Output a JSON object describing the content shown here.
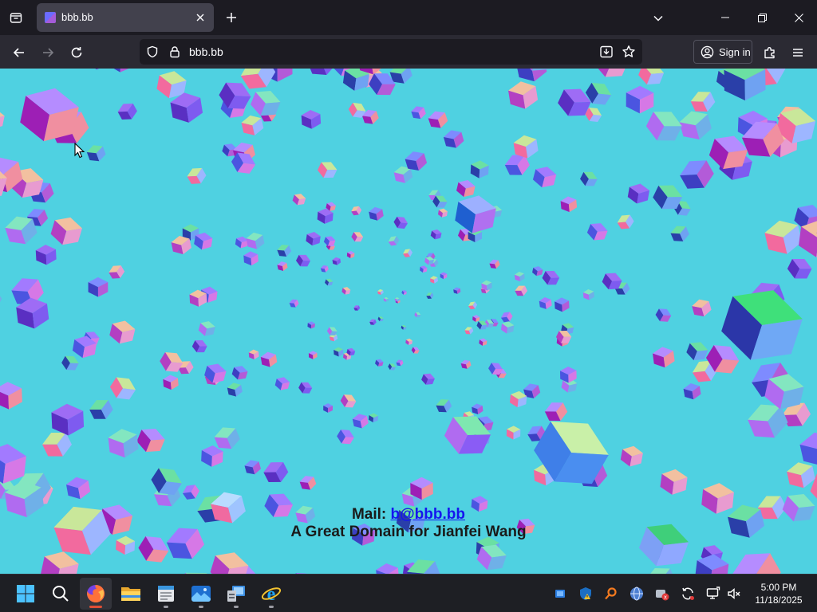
{
  "tab": {
    "title": "bbb.bb"
  },
  "address_bar": {
    "url": "bbb.bb"
  },
  "toolbar": {
    "signin_label": "Sign in"
  },
  "page": {
    "mail_label": "Mail:",
    "mail_link": "b@bbb.bb",
    "tagline": "A Great Domain for Jianfei Wang"
  },
  "taskbar": {
    "apps": [
      "start-icon",
      "search-icon",
      "firefox-icon",
      "file-explorer-icon",
      "notepad-icon",
      "photos-icon",
      "control-panel-icon",
      "internet-explorer-icon"
    ],
    "tray_icons": [
      "onedrive-icon",
      "defender-icon",
      "search-tool-icon",
      "network-globe-icon",
      "bluetooth-icon",
      "sync-icon",
      "display-icon",
      "volume-muted-icon"
    ]
  },
  "clock": {
    "time": "5:00 PM",
    "date": "11/18/2025"
  },
  "colors": {
    "page_background": "#4fd1e1",
    "link": "#1515ee",
    "accent": "#e04f35"
  }
}
